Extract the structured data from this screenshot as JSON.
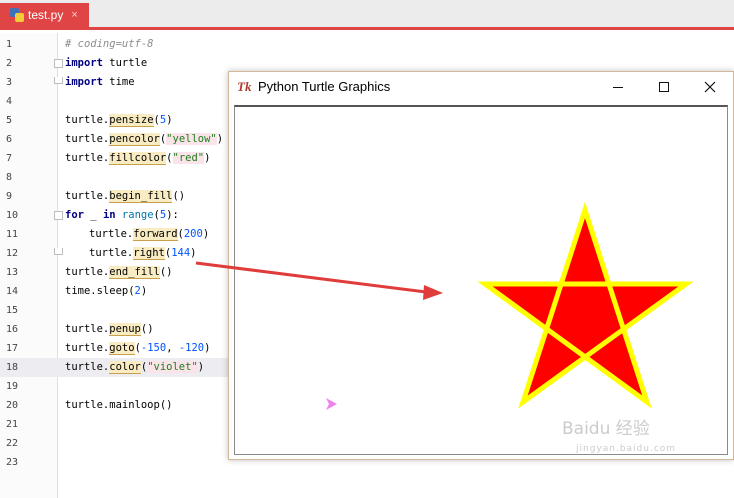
{
  "editor": {
    "tab": {
      "label": "test.py",
      "close_glyph": "×"
    },
    "lines": [
      {
        "n": "1",
        "text": "# coding=utf-8"
      },
      {
        "n": "2",
        "text": "import turtle"
      },
      {
        "n": "3",
        "text": "import time"
      },
      {
        "n": "4",
        "text": ""
      },
      {
        "n": "5",
        "text": "turtle.pensize(5)"
      },
      {
        "n": "6",
        "text": "turtle.pencolor(\"yellow\")"
      },
      {
        "n": "7",
        "text": "turtle.fillcolor(\"red\")"
      },
      {
        "n": "8",
        "text": ""
      },
      {
        "n": "9",
        "text": "turtle.begin_fill()"
      },
      {
        "n": "10",
        "text": "for _ in range(5):"
      },
      {
        "n": "11",
        "text": "turtle.forward(200)"
      },
      {
        "n": "12",
        "text": "turtle.right(144)"
      },
      {
        "n": "13",
        "text": "turtle.end_fill()"
      },
      {
        "n": "14",
        "text": "time.sleep(2)"
      },
      {
        "n": "15",
        "text": ""
      },
      {
        "n": "16",
        "text": "turtle.penup()"
      },
      {
        "n": "17",
        "text": "turtle.goto(-150, -120)"
      },
      {
        "n": "18",
        "text": "turtle.color(\"violet\")"
      },
      {
        "n": "19",
        "text": ""
      },
      {
        "n": "20",
        "text": "turtle.mainloop()"
      },
      {
        "n": "21",
        "text": ""
      },
      {
        "n": "22",
        "text": ""
      },
      {
        "n": "23",
        "text": ""
      }
    ],
    "active_line": "18"
  },
  "turtle_window": {
    "title": "Python Turtle Graphics",
    "icon": "tk-feather-icon",
    "icon_text": "Tk",
    "star": {
      "fill": "#ff0000",
      "stroke": "#ffff00"
    },
    "turtle_color": "#ee82ee"
  },
  "watermark": {
    "logo": "Baidu 经验",
    "url": "jingyan.baidu.com"
  },
  "colors": {
    "tab_accent": "#e04545",
    "arrow": "#e03c3c"
  }
}
